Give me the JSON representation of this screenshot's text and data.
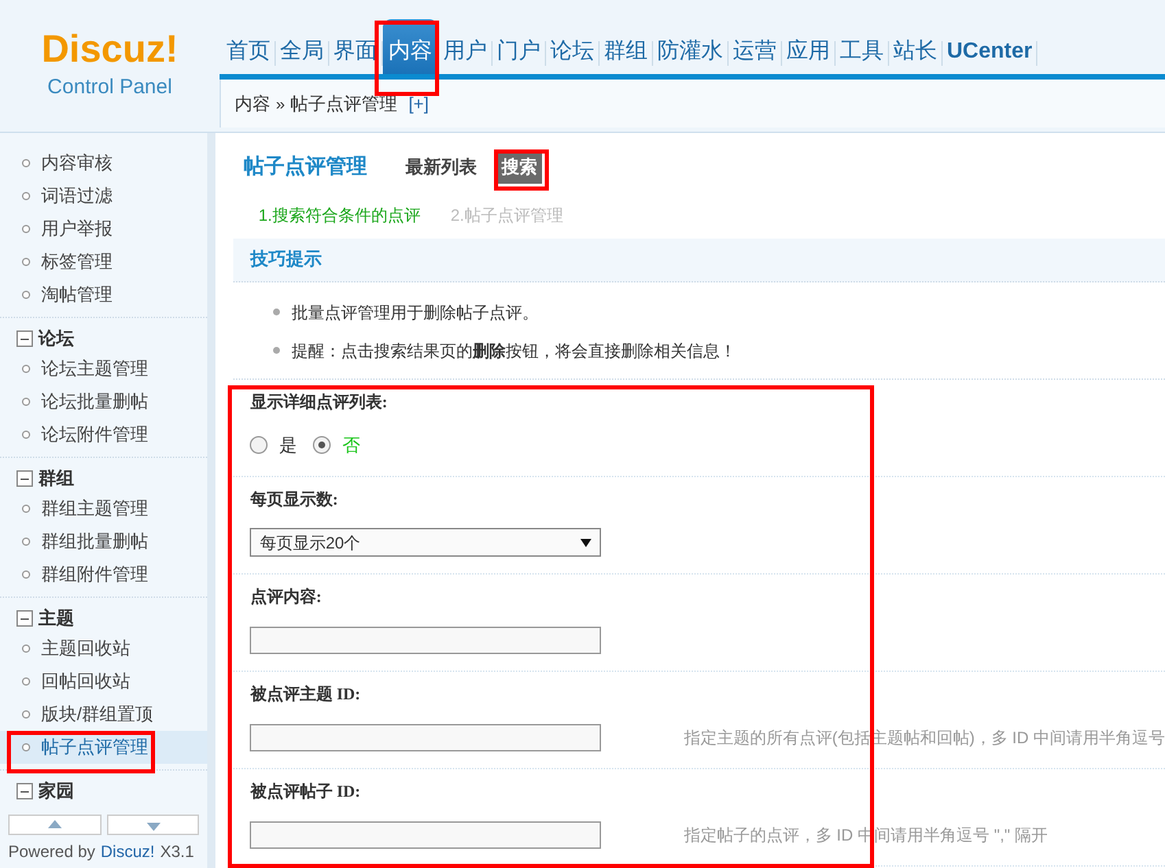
{
  "header": {
    "logo": {
      "title": "Discuz!",
      "subtitle": "Control Panel"
    },
    "nav": [
      {
        "label": "首页",
        "selected": false
      },
      {
        "label": "全局",
        "selected": false
      },
      {
        "label": "界面",
        "selected": false
      },
      {
        "label": "内容",
        "selected": true
      },
      {
        "label": "用户",
        "selected": false
      },
      {
        "label": "门户",
        "selected": false
      },
      {
        "label": "论坛",
        "selected": false
      },
      {
        "label": "群组",
        "selected": false
      },
      {
        "label": "防灌水",
        "selected": false
      },
      {
        "label": "运营",
        "selected": false
      },
      {
        "label": "应用",
        "selected": false
      },
      {
        "label": "工具",
        "selected": false
      },
      {
        "label": "站长",
        "selected": false
      },
      {
        "label": "UCenter",
        "selected": false
      }
    ],
    "breadcrumb": {
      "path": [
        "内容",
        "帖子点评管理"
      ],
      "separator": "»",
      "add": "[+]"
    }
  },
  "sidebar": {
    "groups": [
      {
        "items": [
          {
            "label": "内容审核",
            "selected": false
          },
          {
            "label": "词语过滤",
            "selected": false
          },
          {
            "label": "用户举报",
            "selected": false
          },
          {
            "label": "标签管理",
            "selected": false
          },
          {
            "label": "淘帖管理",
            "selected": false
          }
        ]
      },
      {
        "title": "论坛",
        "items": [
          {
            "label": "论坛主题管理",
            "selected": false
          },
          {
            "label": "论坛批量删帖",
            "selected": false
          },
          {
            "label": "论坛附件管理",
            "selected": false
          }
        ]
      },
      {
        "title": "群组",
        "items": [
          {
            "label": "群组主题管理",
            "selected": false
          },
          {
            "label": "群组批量删帖",
            "selected": false
          },
          {
            "label": "群组附件管理",
            "selected": false
          }
        ]
      },
      {
        "title": "主题",
        "items": [
          {
            "label": "主题回收站",
            "selected": false
          },
          {
            "label": "回帖回收站",
            "selected": false
          },
          {
            "label": "版块/群组置顶",
            "selected": false
          },
          {
            "label": "帖子点评管理",
            "selected": true
          }
        ]
      },
      {
        "title": "家园"
      }
    ],
    "footer": {
      "prefix": "Powered by",
      "product": "Discuz!",
      "version": "X3.1"
    }
  },
  "main": {
    "title": "帖子点评管理",
    "tabs": [
      {
        "label": "最新列表",
        "selected": false
      },
      {
        "label": "搜索",
        "selected": true
      }
    ],
    "steps": [
      {
        "label": "1.搜索符合条件的点评",
        "selected": true
      },
      {
        "label": "2.帖子点评管理",
        "selected": false
      }
    ],
    "tips": {
      "title": "技巧提示",
      "items": [
        "批量点评管理用于删除帖子点评。",
        "提醒：点击搜索结果页的**删除**按钮，将会直接删除相关信息！"
      ]
    },
    "form": [
      {
        "kind": "radio",
        "label": "显示详细点评列表:",
        "options": [
          {
            "label": "是",
            "selected": false
          },
          {
            "label": "否",
            "selected": true
          }
        ]
      },
      {
        "kind": "select",
        "label": "每页显示数:",
        "value": "每页显示20个"
      },
      {
        "kind": "text",
        "label": "点评内容:"
      },
      {
        "kind": "text",
        "label": "被点评主题 ID:",
        "hint": "指定主题的所有点评(包括主题帖和回帖)，多 ID 中间请用半角逗号"
      },
      {
        "kind": "text",
        "label": "被点评帖子 ID:",
        "hint": "指定帖子的点评，多 ID 中间请用半角逗号 \",\" 隔开"
      }
    ]
  }
}
